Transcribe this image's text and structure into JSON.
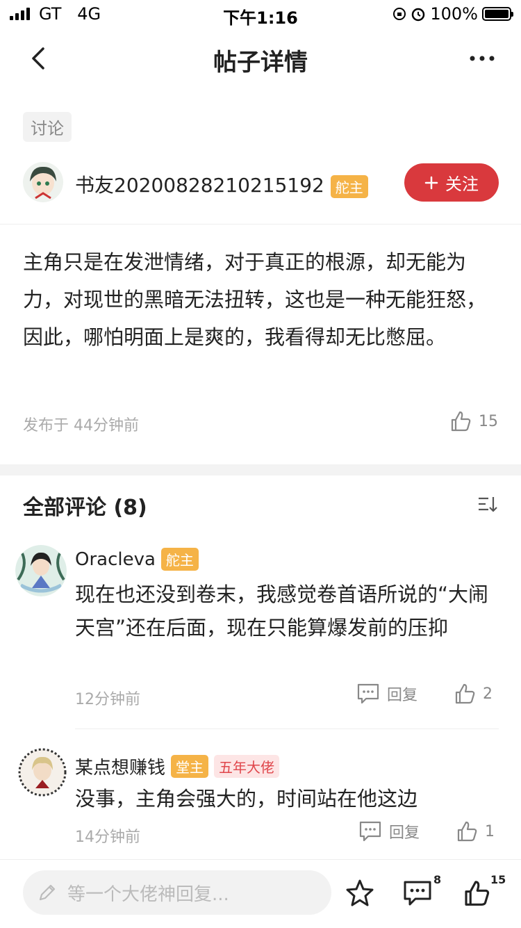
{
  "status_bar": {
    "carrier": "GT   4G",
    "time": "下午1:16",
    "battery": "100%"
  },
  "nav": {
    "title": "帖子详情"
  },
  "post": {
    "tag": "讨论",
    "author": "书友20200828210215192",
    "author_badge": "舵主",
    "follow_label": "关注",
    "content": "主角只是在发泄情绪，对于真正的根源，却无能为力，对现世的黑暗无法扭转，这也是一种无能狂怒，因此，哪怕明面上是爽的，我看得却无比憋屈。",
    "published": "发布于 44分钟前",
    "likes": "15"
  },
  "comments": {
    "title": "全部评论 (8)",
    "items": [
      {
        "name": "Oracleva",
        "badges": [
          "舵主"
        ],
        "text": "现在也还没到卷末，我感觉卷首语所说的“大闹天宫”还在后面，现在只能算爆发前的压抑",
        "time": "12分钟前",
        "reply": "回复",
        "likes": "2"
      },
      {
        "name": "某点想赚钱",
        "badges": [
          "堂主",
          "五年大佬"
        ],
        "text": "没事，主角会强大的，时间站在他这边",
        "time": "14分钟前",
        "reply": "回复",
        "likes": "1"
      }
    ]
  },
  "bottom_bar": {
    "placeholder": "等一个大佬神回复...",
    "comment_count": "8",
    "like_count": "15"
  },
  "colors": {
    "accent_red": "#d9393d",
    "badge_orange": "#f5b347",
    "badge_pink_bg": "#fde5e5",
    "badge_pink_text": "#e0464b"
  },
  "icons": [
    "back-icon",
    "more-icon",
    "plus-icon",
    "thumbs-up-icon",
    "sort-icon",
    "comment-icon",
    "pencil-icon",
    "star-icon"
  ]
}
